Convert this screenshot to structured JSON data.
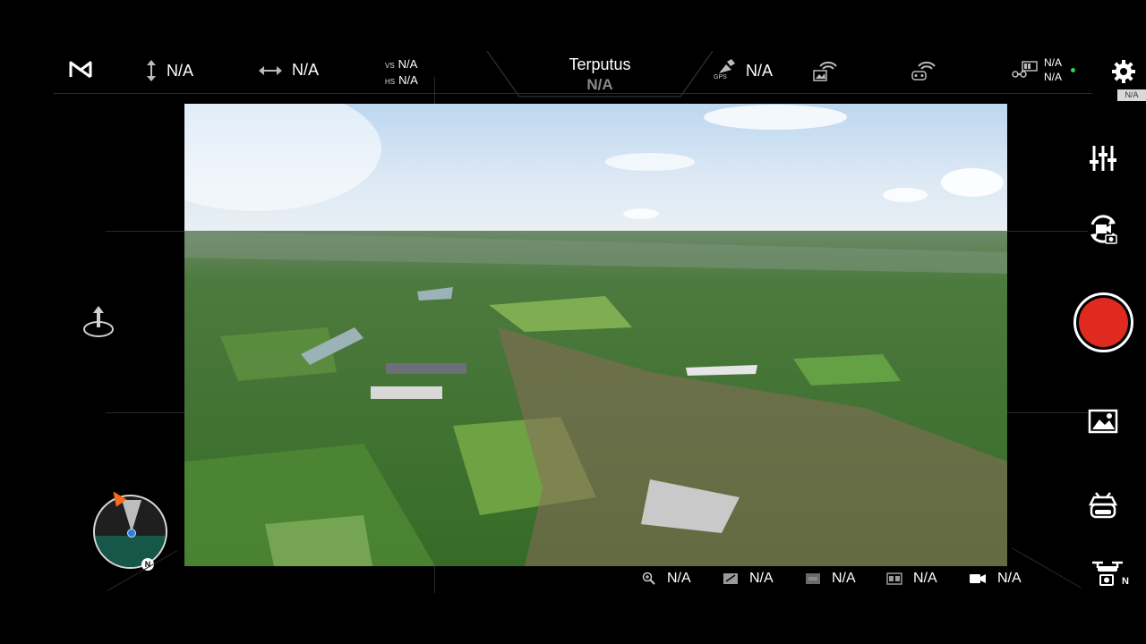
{
  "header": {
    "height_value": "N/A",
    "distance_value": "N/A",
    "vs_label": "VS",
    "vs_value": "N/A",
    "hs_label": "HS",
    "hs_value": "N/A",
    "connection_status": "Terputus",
    "connection_sub": "N/A",
    "gps_label": "GPS",
    "gps_value": "N/A",
    "battery_value_1": "N/A",
    "battery_value_2": "N/A",
    "settings_tag": "N/A"
  },
  "footer": {
    "zoom_value": "N/A",
    "ev_value": "N/A",
    "iso_value": "N/A",
    "shutter_value": "N/A",
    "video_value": "N/A"
  },
  "compass": {
    "north_label": "N"
  },
  "drone_mode_label": "N",
  "colors": {
    "record": "#e02a1f",
    "status_dot": "#2fd34a",
    "compass_ground": "#17574a",
    "heading_arrow": "#ff6a1a"
  }
}
